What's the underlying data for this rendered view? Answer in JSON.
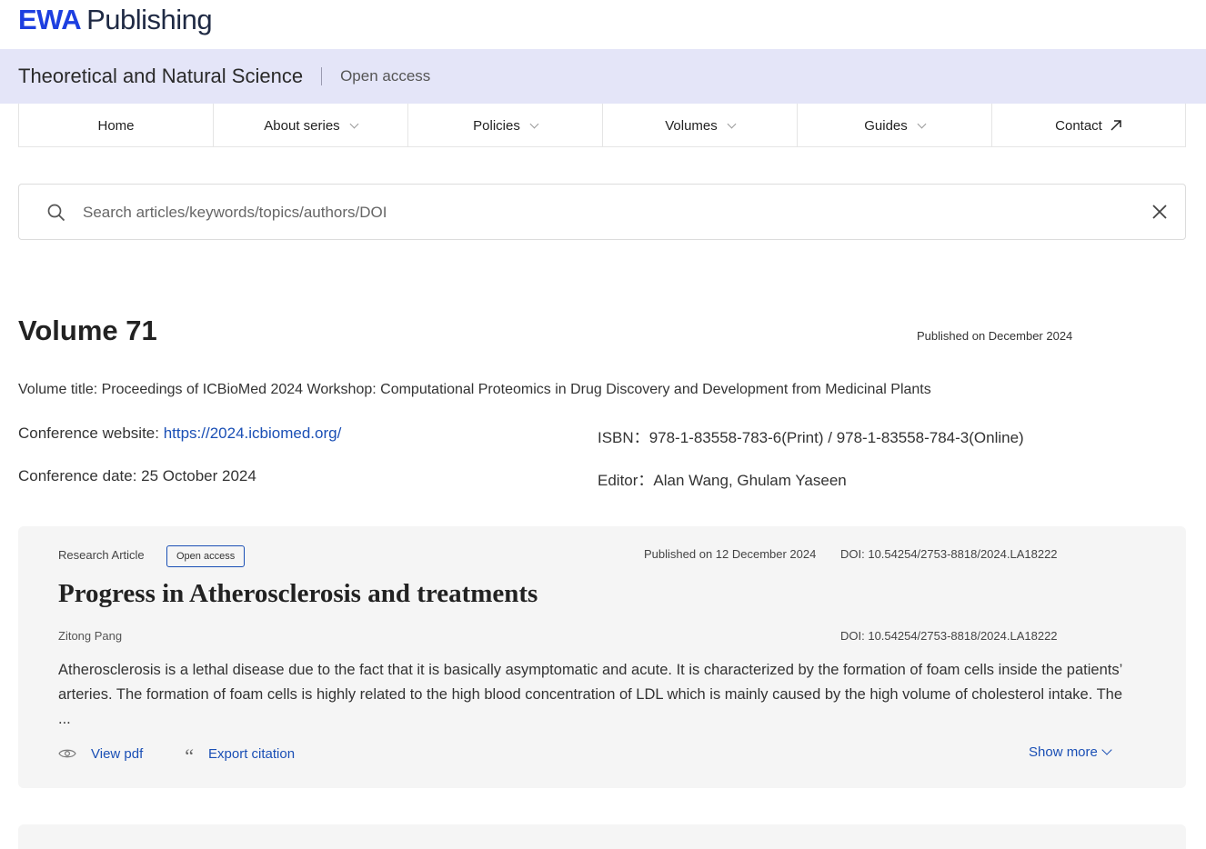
{
  "brand": {
    "logo_primary": "EWA",
    "logo_secondary": "Publishing",
    "accent_color": "#1d3fe0"
  },
  "series": {
    "title": "Theoretical and Natural Science",
    "access": "Open access"
  },
  "nav": {
    "items": [
      {
        "label": "Home"
      },
      {
        "label": "About series"
      },
      {
        "label": "Policies"
      },
      {
        "label": "Volumes"
      },
      {
        "label": "Guides"
      },
      {
        "label": "Contact"
      }
    ]
  },
  "search": {
    "placeholder": "Search articles/keywords/topics/authors/DOI",
    "value": ""
  },
  "volume": {
    "title": "Volume 71",
    "published": "Published on December 2024",
    "subtitle": "Volume title: Proceedings of ICBioMed 2024 Workshop: Computational Proteomics in Drug Discovery and Development from Medicinal Plants",
    "website_label": "Conference website: ",
    "website_url": "https://2024.icbiomed.org/",
    "isbn_label": "ISBN：",
    "isbn": "978-1-83558-783-6(Print) / 978-1-83558-784-3(Online)",
    "date_label": "Conference date: ",
    "date": "25 October 2024",
    "editor_label": "Editor：",
    "editor": "Alan Wang, Ghulam Yaseen"
  },
  "articles": [
    {
      "type": "Research Article",
      "badge": "Open access",
      "published": "Published on 12 December 2024",
      "doi_top": "DOI: 10.54254/2753-8818/2024.LA18222",
      "title": "Progress in Atherosclerosis and treatments",
      "author": "Zitong Pang",
      "doi": "DOI: 10.54254/2753-8818/2024.LA18222",
      "abstract": "Atherosclerosis is a lethal disease due to the fact that it is basically asymptomatic and acute. It is characterized by the formation of foam cells inside the patients’ arteries. The formation of foam cells is highly related to the high blood concentration of LDL which is mainly caused by the high volume of cholesterol intake. The ...",
      "view_pdf": "View pdf",
      "export_citation": "Export citation",
      "show_more": "Show more"
    }
  ],
  "icons": {
    "search": "search-icon",
    "close": "close-icon",
    "external": "arrow-up-right-icon",
    "eye": "eye-icon",
    "quote": "quote-icon",
    "chevron": "chevron-down-icon"
  }
}
